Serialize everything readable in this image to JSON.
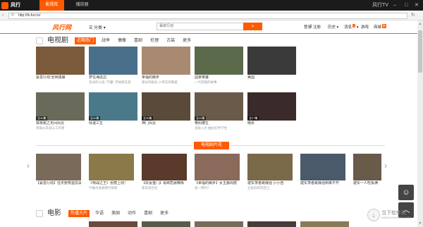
{
  "app": {
    "brand": "风行",
    "tabs": [
      {
        "label": "影视库",
        "active": true
      },
      {
        "label": "播放器",
        "active": false
      }
    ],
    "window_title": "风行TV",
    "address": "http://fs.fun.tv/"
  },
  "site": {
    "logo": "风行网",
    "category": "分类",
    "search_placeholder": "幂欲行动",
    "links": {
      "login": "登录",
      "register": "注册",
      "history": "历史",
      "messages": "消息",
      "messages_badge": "1",
      "games": "游戏",
      "mall": "商城",
      "mall_badge": "新"
    }
  },
  "tv": {
    "title": "电视剧",
    "tabs": [
      {
        "label": "近期热门",
        "active": true
      },
      {
        "label": "战争",
        "active": false
      },
      {
        "label": "偶像",
        "active": false
      },
      {
        "label": "喜剧",
        "active": false
      },
      {
        "label": "伦理",
        "active": false
      },
      {
        "label": "古装",
        "active": false
      },
      {
        "label": "更多",
        "active": false
      }
    ],
    "row1": [
      {
        "title": "紧急行动:全网独播",
        "sub": "",
        "badge": "",
        "color": "#7a5a3a"
      },
      {
        "title": "梦在海这边",
        "sub": "洗冰的火焰 \"学霸\" 开始新征程",
        "badge": "",
        "color": "#4a6f8a"
      },
      {
        "title": "幸福的脚步",
        "sub": "家长的眼光 小孝在四哪里",
        "badge": "",
        "color": "#a88a70"
      },
      {
        "title": "国家英雄",
        "sub": "一代英雄的故事",
        "badge": "",
        "color": "#5a6a4a"
      },
      {
        "title": "美国",
        "sub": "",
        "badge": "",
        "color": "#3a3a3a"
      }
    ],
    "row2": [
      {
        "title": "铁核桃之无间风云",
        "sub": "英雄从军战斗工作者",
        "badge": "全40集",
        "color": "#6a6a5a"
      },
      {
        "title": "情谊三生",
        "sub": "",
        "badge": "全40集",
        "color": "#4a7a8a"
      },
      {
        "title": "神门风云",
        "sub": "",
        "badge": "全38集",
        "color": "#5a4a3a"
      },
      {
        "title": "艳阳蓬生",
        "sub": "战役入乡 曲比纪中学生",
        "badge": "全40集",
        "color": "#6a5a4a"
      },
      {
        "title": "绝杀",
        "sub": "",
        "badge": "全37集",
        "color": "#3a2a2a"
      }
    ]
  },
  "clips": {
    "pill": "电视剧片花",
    "items": [
      {
        "title": "【紧急行动】任天野类墨抗战",
        "sub": "",
        "color": "#7a6a5a"
      },
      {
        "title": "《特战之王》张丽上线！",
        "sub": "午睡为张丽愿打败帮",
        "color": "#8a7a4a"
      },
      {
        "title": "【欢喜重门】肖郎危晨精炼",
        "sub": "家去县召任",
        "color": "#5a3a2a"
      },
      {
        "title": "【幸福的脚步】女主都周唐",
        "sub": "会一把吗？",
        "color": "#8a6a5a"
      },
      {
        "title": "建东李者跳爆强 小小自",
        "sub": "立投旧新年回上",
        "color": "#7a6a4a"
      },
      {
        "title": "建东李者跳爆强到离不开",
        "sub": "",
        "color": "#4a5a6a"
      },
      {
        "title": "建东一人吃饭满",
        "sub": "",
        "color": "#6a5a4a"
      }
    ]
  },
  "movie": {
    "title": "电影",
    "tabs": [
      {
        "label": "热播大片",
        "active": true
      },
      {
        "label": "华语",
        "active": false
      },
      {
        "label": "美国",
        "active": false
      },
      {
        "label": "动作",
        "active": false
      },
      {
        "label": "喜剧",
        "active": false
      },
      {
        "label": "更多",
        "active": false
      }
    ]
  },
  "watermark": {
    "brand": "当下软件园",
    "sub": "WWW.DOWNXIA.COM"
  },
  "icons": {
    "chat": "chat-icon",
    "top": "back-to-top-icon"
  }
}
